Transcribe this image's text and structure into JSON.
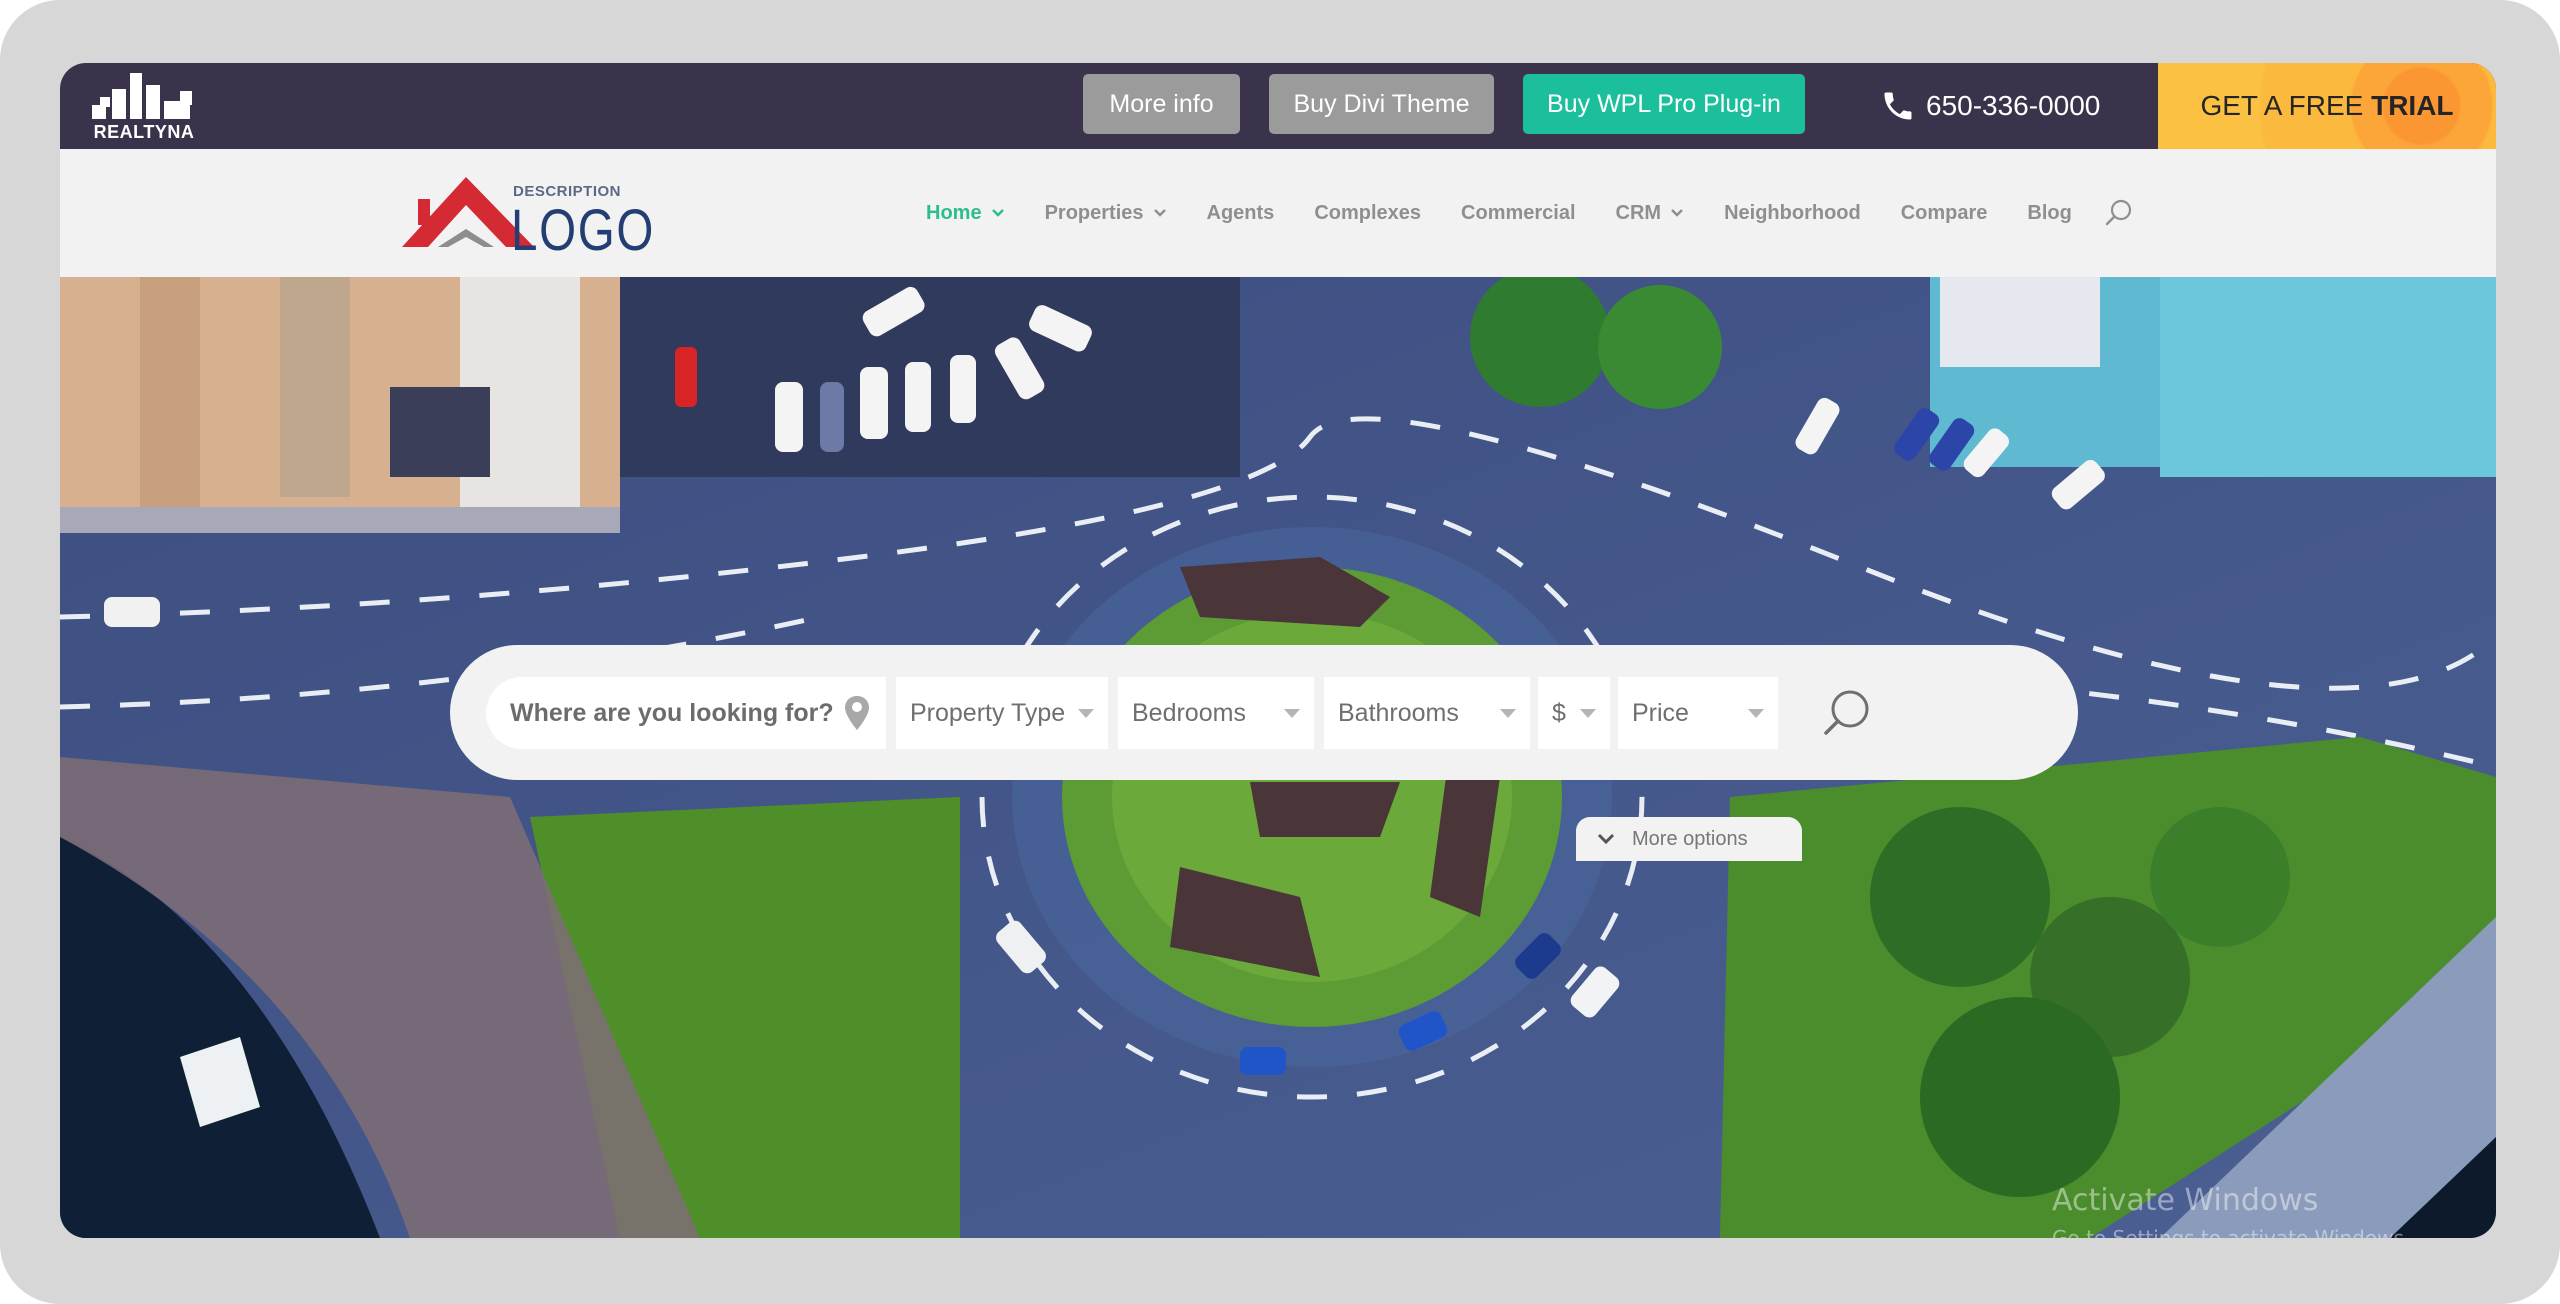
{
  "topbar": {
    "brand": "REALTYNA",
    "buttons": [
      {
        "label": "More info",
        "style": "gray"
      },
      {
        "label": "Buy Divi Theme",
        "style": "gray"
      },
      {
        "label": "Buy WPL Pro Plug-in",
        "style": "green"
      }
    ],
    "phone": "650-336-0000",
    "trial": {
      "prefix": "GET A FREE",
      "emphasis": "TRIAL"
    }
  },
  "logo": {
    "description": "DESCRIPTION",
    "word": "LOGO"
  },
  "nav": {
    "items": [
      {
        "label": "Home",
        "dropdown": true,
        "active": true
      },
      {
        "label": "Properties",
        "dropdown": true,
        "active": false
      },
      {
        "label": "Agents",
        "dropdown": false,
        "active": false
      },
      {
        "label": "Complexes",
        "dropdown": false,
        "active": false
      },
      {
        "label": "Commercial",
        "dropdown": false,
        "active": false
      },
      {
        "label": "CRM",
        "dropdown": true,
        "active": false
      },
      {
        "label": "Neighborhood",
        "dropdown": false,
        "active": false
      },
      {
        "label": "Compare",
        "dropdown": false,
        "active": false
      },
      {
        "label": "Blog",
        "dropdown": false,
        "active": false
      }
    ],
    "search_icon": "search-icon"
  },
  "search": {
    "more_options": "More options",
    "location_placeholder": "Where are you looking for?",
    "property_type": "Property Type",
    "bedrooms": "Bedrooms",
    "bathrooms": "Bathrooms",
    "currency": "$",
    "price": "Price"
  },
  "watermark": {
    "title": "Activate Windows",
    "subtitle": "Go to Settings to activate Windows."
  },
  "colors": {
    "topbar": "#3b334b",
    "accent_green": "#1cbf9c",
    "nav_active": "#2ebd8f",
    "trial_orange": "#fbb93d"
  }
}
